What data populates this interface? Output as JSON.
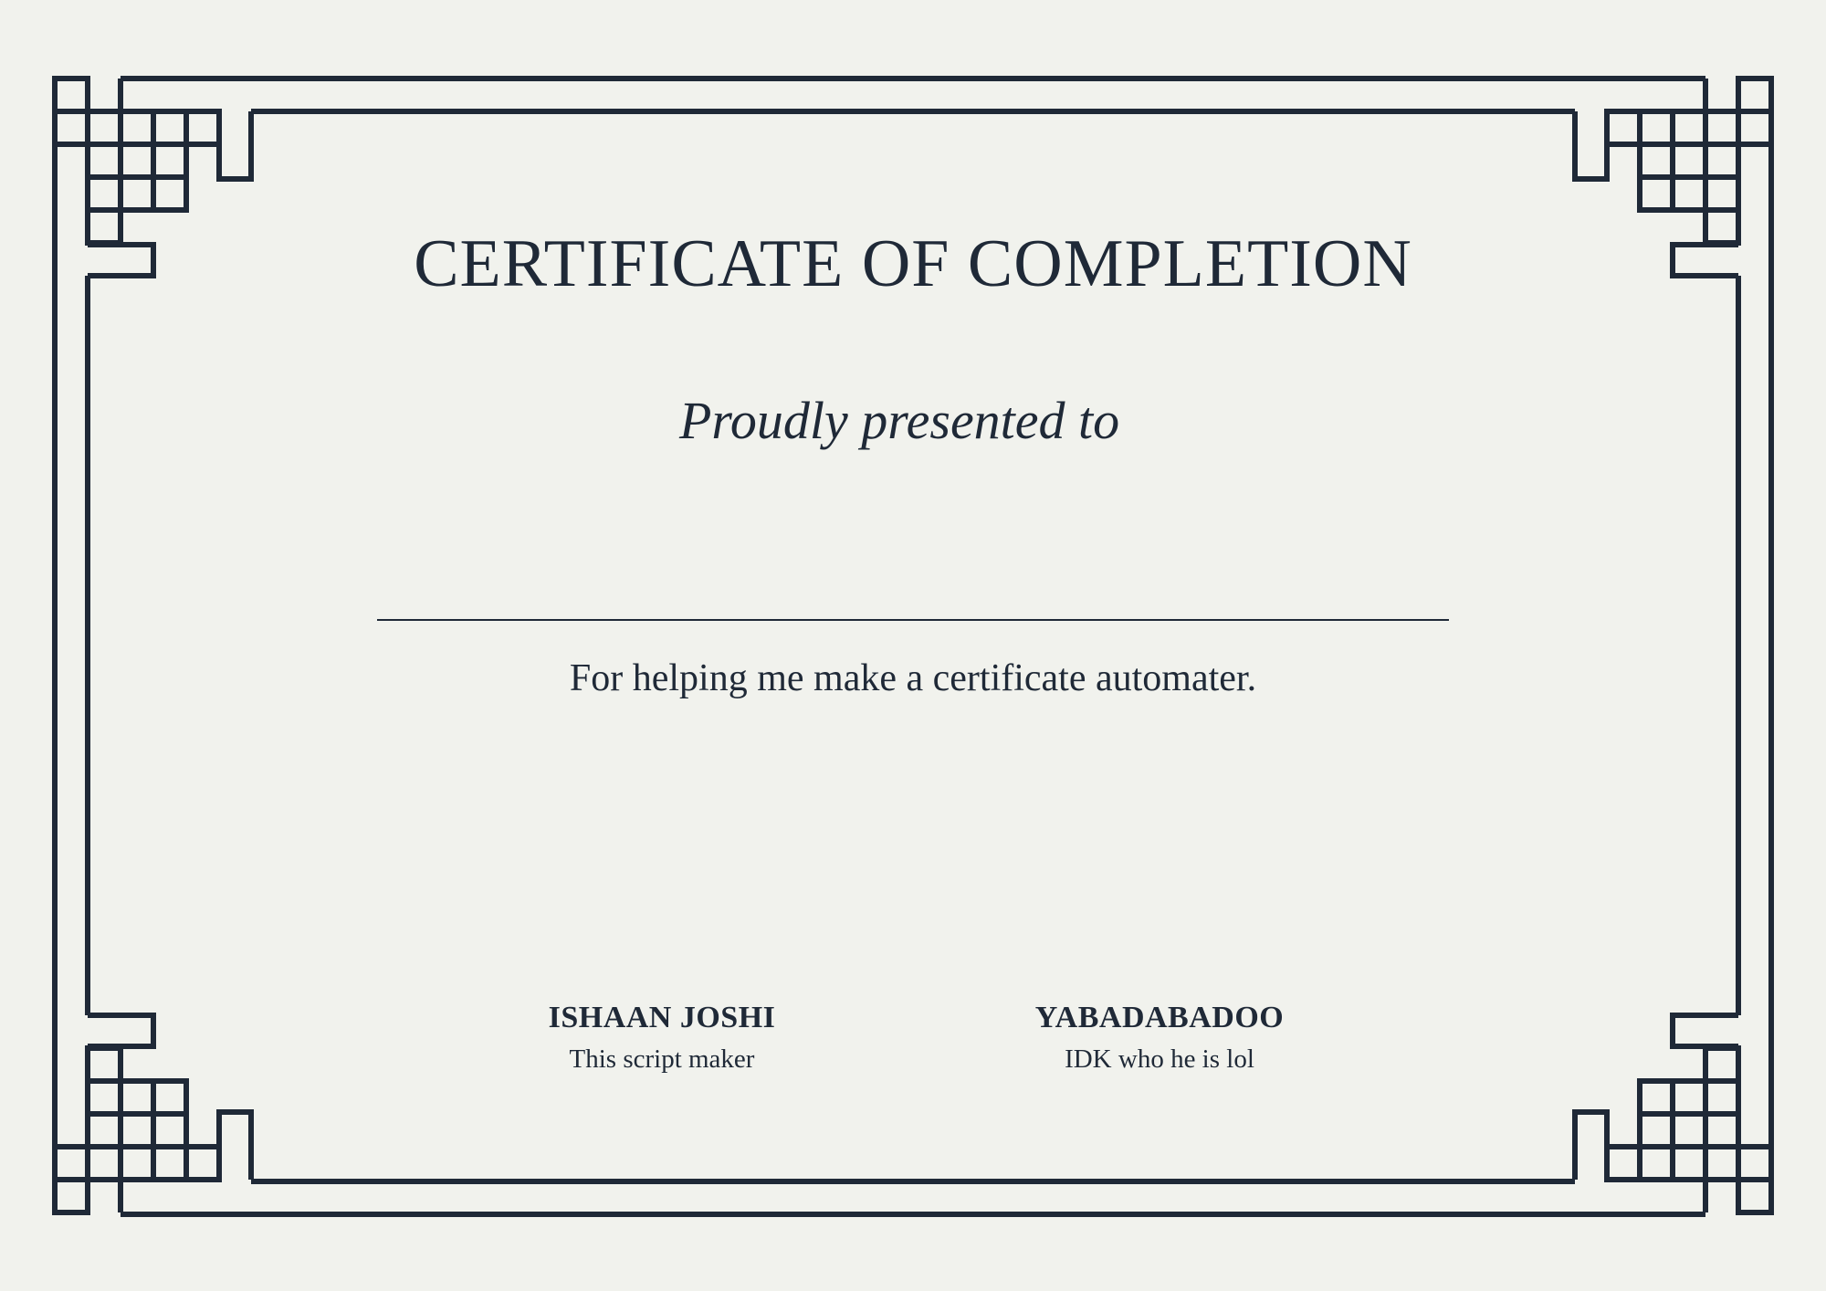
{
  "certificate": {
    "title": "CERTIFICATE OF COMPLETION",
    "subtitle": "Proudly presented to",
    "recipient_name": "",
    "description": "For helping me make a certificate automater."
  },
  "signatories": [
    {
      "name": "ISHAAN JOSHI",
      "role": "This script maker"
    },
    {
      "name": "YABADABADOO",
      "role": "IDK who he is lol"
    }
  ],
  "colors": {
    "background": "#f1f2ed",
    "ink": "#1f2937"
  },
  "decorations": {
    "border_icon": "greek-key-border-icon"
  }
}
